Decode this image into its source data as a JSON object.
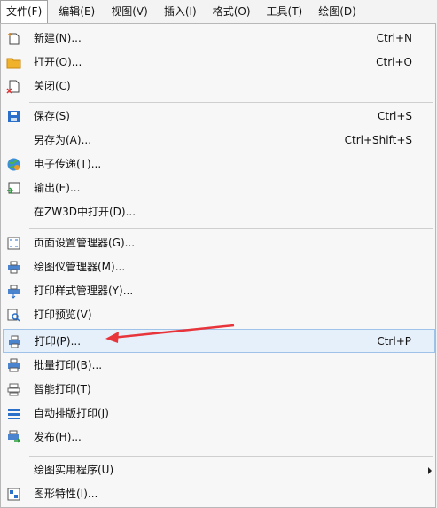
{
  "menubar": {
    "items": [
      {
        "label": "文件(F)",
        "active": true
      },
      {
        "label": "编辑(E)"
      },
      {
        "label": "视图(V)"
      },
      {
        "label": "插入(I)"
      },
      {
        "label": "格式(O)"
      },
      {
        "label": "工具(T)"
      },
      {
        "label": "绘图(D)"
      }
    ]
  },
  "menu": {
    "items": [
      {
        "label": "新建(N)...",
        "shortcut": "Ctrl+N",
        "icon": "new-icon"
      },
      {
        "label": "打开(O)...",
        "shortcut": "Ctrl+O",
        "icon": "open-folder-icon"
      },
      {
        "label": "关闭(C)",
        "shortcut": "",
        "icon": "close-document-icon"
      },
      {
        "label": "保存(S)",
        "shortcut": "Ctrl+S",
        "icon": "save-icon"
      },
      {
        "label": "另存为(A)...",
        "shortcut": "Ctrl+Shift+S",
        "icon": ""
      },
      {
        "label": "电子传递(T)...",
        "shortcut": "",
        "icon": "etransmit-icon"
      },
      {
        "label": "输出(E)...",
        "shortcut": "",
        "icon": "export-icon"
      },
      {
        "label": "在ZW3D中打开(D)...",
        "shortcut": "",
        "icon": ""
      },
      {
        "label": "页面设置管理器(G)...",
        "shortcut": "",
        "icon": "page-setup-icon"
      },
      {
        "label": "绘图仪管理器(M)...",
        "shortcut": "",
        "icon": "plotter-icon"
      },
      {
        "label": "打印样式管理器(Y)...",
        "shortcut": "",
        "icon": "plot-style-icon"
      },
      {
        "label": "打印预览(V)",
        "shortcut": "",
        "icon": "print-preview-icon"
      },
      {
        "label": "打印(P)...",
        "shortcut": "Ctrl+P",
        "icon": "printer-icon"
      },
      {
        "label": "批量打印(B)...",
        "shortcut": "",
        "icon": "batch-print-icon"
      },
      {
        "label": "智能打印(T)",
        "shortcut": "",
        "icon": "smart-print-icon"
      },
      {
        "label": "自动排版打印(J)",
        "shortcut": "",
        "icon": "auto-layout-print-icon"
      },
      {
        "label": "发布(H)...",
        "shortcut": "",
        "icon": "publish-icon"
      },
      {
        "label": "绘图实用程序(U)",
        "shortcut": "",
        "icon": "",
        "submenu": true
      },
      {
        "label": "图形特性(I)...",
        "shortcut": "",
        "icon": "drawing-properties-icon"
      }
    ]
  },
  "colors": {
    "accent": "#2a6fc9",
    "annotation": "#e8353b",
    "hover_bg": "#e6f0fa",
    "hover_border": "#9fc3e8"
  }
}
